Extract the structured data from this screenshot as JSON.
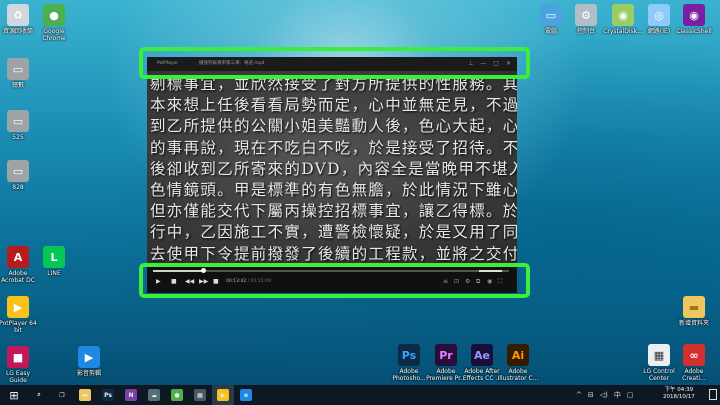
{
  "desktop_left": [
    {
      "label": "資源回收筒",
      "icon": "recycle-bin-icon",
      "color": "#cfd8dc",
      "glyph": "♻"
    },
    {
      "label": "Google\nChrome",
      "icon": "chrome-icon",
      "color": "#4caf50",
      "glyph": "●"
    },
    {
      "label": "總數",
      "icon": "drive-icon",
      "color": "#9ea3a8",
      "glyph": "▭"
    },
    {
      "label": "525",
      "icon": "drive-icon",
      "color": "#9ea3a8",
      "glyph": "▭"
    },
    {
      "label": "828",
      "icon": "drive-icon",
      "color": "#9ea3a8",
      "glyph": "▭"
    },
    {
      "label": "Adobe\nAcrobat DC",
      "icon": "acrobat-icon",
      "color": "#b71c1c",
      "glyph": "A"
    },
    {
      "label": "LINE",
      "icon": "line-icon",
      "color": "#06c755",
      "glyph": "L"
    },
    {
      "label": "PotPlayer 64\nbit",
      "icon": "potplayer-icon",
      "color": "#f9c21a",
      "glyph": "▶"
    },
    {
      "label": "LG Easy\nGuide",
      "icon": "lg-guide-icon",
      "color": "#c2185b",
      "glyph": "■"
    },
    {
      "label": "影音剪輯",
      "icon": "video-editor-icon",
      "color": "#1e88e5",
      "glyph": "▶"
    }
  ],
  "desktop_top_right": [
    {
      "label": "電腦",
      "icon": "computer-icon",
      "color": "#4aa3df",
      "glyph": "▭"
    },
    {
      "label": "控制台",
      "icon": "control-panel-icon",
      "color": "#b0bec5",
      "glyph": "⚙"
    },
    {
      "label": "CrystalDisk...",
      "icon": "crystaldisk-icon",
      "color": "#9ccc65",
      "glyph": "◉"
    },
    {
      "label": "網路(IE)",
      "icon": "network-icon",
      "color": "#90caf9",
      "glyph": "◎"
    },
    {
      "label": "ClassicShell",
      "icon": "classicshell-icon",
      "color": "#7b1fa2",
      "glyph": "◉"
    }
  ],
  "desktop_bottom_right": [
    {
      "label": "Adobe\nPhotosho...",
      "icon": "photoshop-icon",
      "color": "#0b2a43",
      "glyph": "Ps",
      "fg": "#31a8ff"
    },
    {
      "label": "Adobe\nPremiere Pr...",
      "icon": "premiere-icon",
      "color": "#2a0d3a",
      "glyph": "Pr",
      "fg": "#e77cff"
    },
    {
      "label": "Adobe After\nEffects CC ...",
      "icon": "after-effects-icon",
      "color": "#1b0d3a",
      "glyph": "Ae",
      "fg": "#9999ff"
    },
    {
      "label": "Adobe\nIllustrator C...",
      "icon": "illustrator-icon",
      "color": "#331c00",
      "glyph": "Ai",
      "fg": "#ff9a00"
    },
    {
      "label": "LG Control\nCenter",
      "icon": "lg-control-icon",
      "color": "#eceff1",
      "glyph": "▦",
      "fg": "#333"
    },
    {
      "label": "Adobe\nCreati...",
      "icon": "creative-cloud-icon",
      "color": "#d32f2f",
      "glyph": "∞"
    },
    {
      "label": "新增資料夾",
      "icon": "folder-icon",
      "color": "#f0c75e",
      "glyph": "▬",
      "fg": "#a07a1a"
    }
  ],
  "player": {
    "app_name": "PotPlayer",
    "title": "播放列表清单第三课：奇迹.mp4",
    "window_buttons": {
      "pin": "⊥",
      "minimize": "—",
      "maximize": "□",
      "close": "✕"
    },
    "subtitle_lines": [
      "剔標事宜，並欣然接受了對方所提供的性服務。其實",
      "本來想上任後看看局勢而定，心中並無定見，不過當傾",
      "到乙所提供的公關小姐美豔動人後，色心大起，心想以",
      "的事再說，現在不吃白不吃，於是接受了招待。不料上",
      "後卻收到乙所寄來的DVD，內容全是當晚甲不堪入目的",
      "色情鏡頭。甲是標準的有色無膽，於此情況下雖心生不",
      "但亦僅能交代下屬丙操控招標事宜，讓乙得標。於工程",
      "行中，乙因施工不實，遭警檢懷疑，於是又用了同樣的",
      "去使甲下令提前撥發了後續的工程款，並將之交付給轄"
    ],
    "seek_progress": 0.14,
    "volume_level": 0.82,
    "time_current": "00:13:42",
    "time_total": "/ 01:15:09",
    "controls": {
      "play": "▶",
      "pause": "■",
      "stop": "■",
      "prev": "◀◀",
      "next": "▶▶"
    },
    "right_controls": [
      "≡",
      "⊡",
      "⚙",
      "⧉",
      "◉",
      "⛶"
    ]
  },
  "taskbar": {
    "start_icon": "⊞",
    "items": [
      {
        "icon": "search-icon",
        "glyph": "⌕",
        "color": "transparent"
      },
      {
        "icon": "task-view-icon",
        "glyph": "❐",
        "color": "transparent"
      },
      {
        "icon": "file-explorer-icon",
        "glyph": "▬",
        "color": "#f0c75e"
      },
      {
        "icon": "photoshop-taskbar-icon",
        "glyph": "Ps",
        "color": "#0b2a43"
      },
      {
        "icon": "onenote-icon",
        "glyph": "N",
        "color": "#7b3fa8"
      },
      {
        "icon": "cloud-icon",
        "glyph": "☁",
        "color": "#546e7a"
      },
      {
        "icon": "chrome-taskbar-icon",
        "glyph": "●",
        "color": "#4caf50"
      },
      {
        "icon": "calculator-icon",
        "glyph": "▦",
        "color": "#455a64"
      },
      {
        "icon": "potplayer-taskbar-icon",
        "glyph": "▶",
        "color": "#f9c21a"
      },
      {
        "icon": "edge-icon",
        "glyph": "e",
        "color": "#1e88e5"
      }
    ],
    "tray": {
      "arrow": "^",
      "network": "⊟",
      "volume": "◁)",
      "ime": "中",
      "notify": "▢"
    },
    "clock_time": "下午 04:39",
    "clock_date": "2018/10/17"
  }
}
